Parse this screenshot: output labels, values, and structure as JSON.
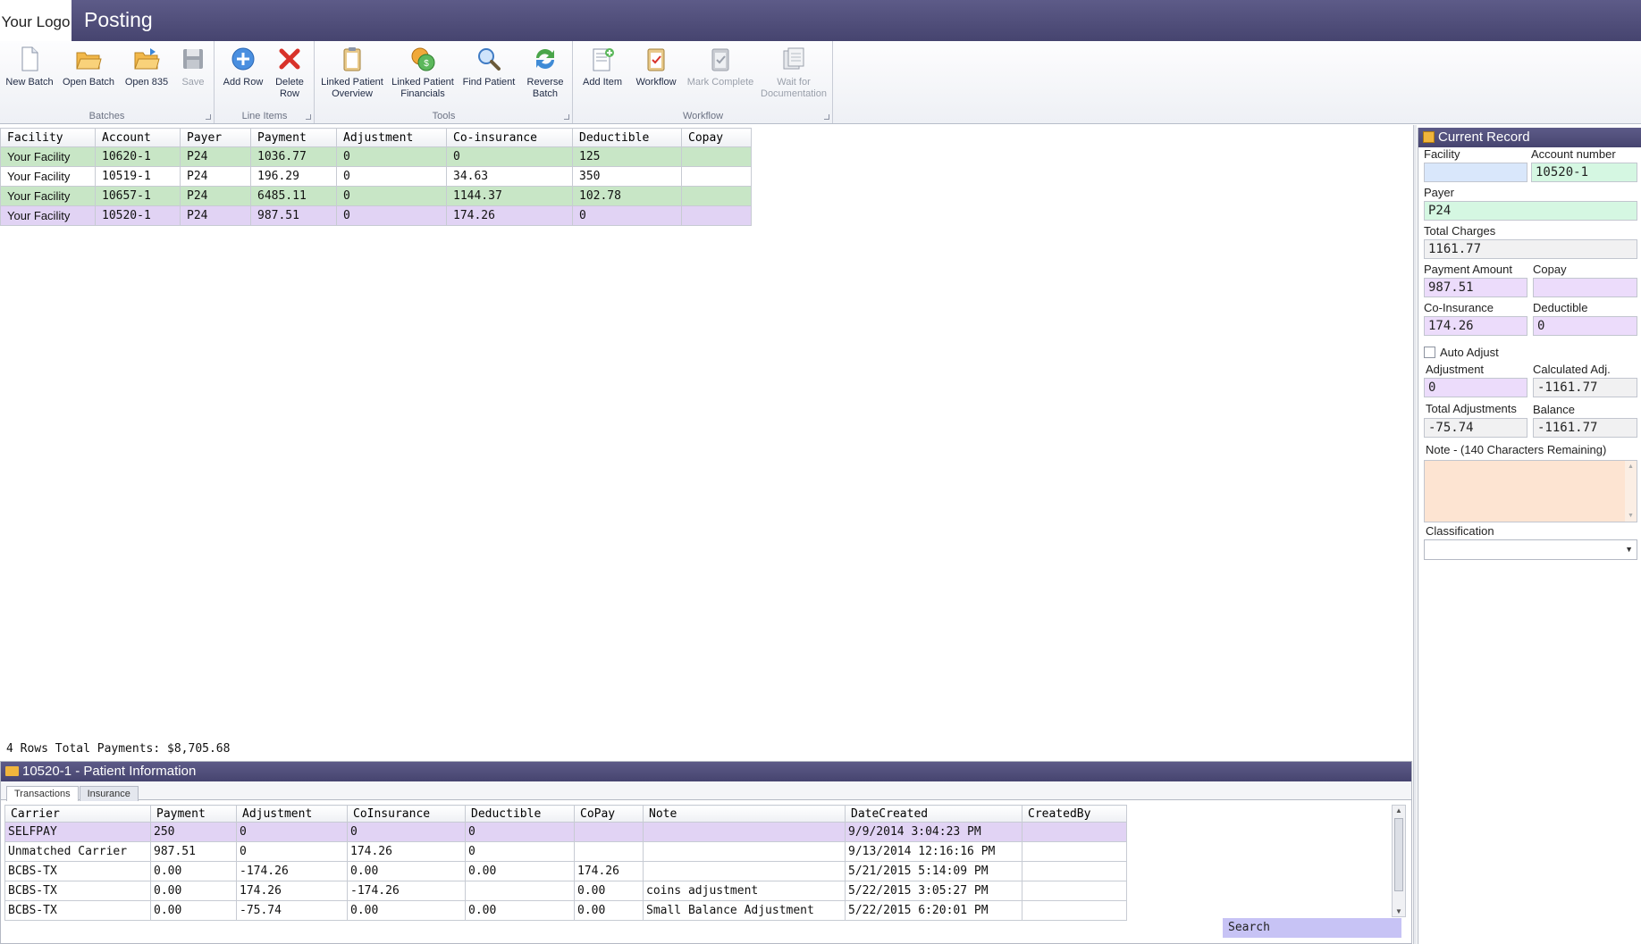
{
  "app": {
    "logo_text": "Your Logo",
    "title": "Posting"
  },
  "ribbon": {
    "groups": [
      {
        "label": "Batches",
        "buttons": [
          {
            "label": "New Batch",
            "icon": "new-document-icon",
            "enabled": true
          },
          {
            "label": "Open Batch",
            "icon": "open-folder-icon",
            "enabled": true
          },
          {
            "label": "Open 835",
            "icon": "open-folder-icon",
            "enabled": true
          },
          {
            "label": "Save",
            "icon": "save-disk-icon",
            "enabled": false
          }
        ]
      },
      {
        "label": "Line Items",
        "buttons": [
          {
            "label": "Add Row",
            "icon": "plus-circle-icon",
            "enabled": true
          },
          {
            "label": "Delete Row",
            "icon": "red-x-icon",
            "enabled": true
          }
        ]
      },
      {
        "label": "Tools",
        "buttons": [
          {
            "label": "Linked Patient Overview",
            "icon": "clipboard-icon",
            "enabled": true
          },
          {
            "label": "Linked Patient Financials",
            "icon": "coins-icon",
            "enabled": true
          },
          {
            "label": "Find Patient",
            "icon": "magnifier-icon",
            "enabled": true
          },
          {
            "label": "Reverse Batch",
            "icon": "refresh-arrows-icon",
            "enabled": true
          }
        ]
      },
      {
        "label": "Workflow",
        "buttons": [
          {
            "label": "Add Item",
            "icon": "add-item-icon",
            "enabled": true
          },
          {
            "label": "Workflow",
            "icon": "workflow-clipboard-icon",
            "enabled": true
          },
          {
            "label": "Mark Complete",
            "icon": "check-clipboard-icon",
            "enabled": false
          },
          {
            "label": "Wait for Documentation",
            "icon": "documents-icon",
            "enabled": false
          }
        ]
      }
    ]
  },
  "batch_grid": {
    "columns": [
      "Facility",
      "Account",
      "Payer",
      "Payment",
      "Adjustment",
      "Co-insurance",
      "Deductible",
      "Copay"
    ],
    "rows": [
      {
        "facility": "Your Facility",
        "account": "10620-1",
        "payer": "P24",
        "payment": "1036.77",
        "adjustment": "0",
        "coinsurance": "0",
        "deductible": "125",
        "copay": "",
        "status": "green"
      },
      {
        "facility": "Your Facility",
        "account": "10519-1",
        "payer": "P24",
        "payment": "196.29",
        "adjustment": "0",
        "coinsurance": "34.63",
        "deductible": "350",
        "copay": "",
        "status": "white"
      },
      {
        "facility": "Your Facility",
        "account": "10657-1",
        "payer": "P24",
        "payment": "6485.11",
        "adjustment": "0",
        "coinsurance": "1144.37",
        "deductible": "102.78",
        "copay": "",
        "status": "green"
      },
      {
        "facility": "Your Facility",
        "account": "10520-1",
        "payer": "P24",
        "payment": "987.51",
        "adjustment": "0",
        "coinsurance": "174.26",
        "deductible": "0",
        "copay": "",
        "status": "selected"
      }
    ],
    "summary": "4 Rows Total Payments: $8,705.68"
  },
  "patient_info": {
    "title": "10520-1 - Patient Information",
    "tabs": [
      "Transactions",
      "Insurance"
    ],
    "active_tab": "Transactions",
    "columns": [
      "Carrier",
      "Payment",
      "Adjustment",
      "CoInsurance",
      "Deductible",
      "CoPay",
      "Note",
      "DateCreated",
      "CreatedBy"
    ],
    "rows": [
      {
        "carrier": "SELFPAY",
        "payment": "250",
        "adjustment": "0",
        "coinsurance": "0",
        "deductible": "0",
        "copay": "",
        "note": "",
        "date": "9/9/2014 3:04:23 PM",
        "created_by": "",
        "selected": true
      },
      {
        "carrier": "Unmatched Carrier",
        "payment": "987.51",
        "adjustment": "0",
        "coinsurance": "174.26",
        "deductible": "0",
        "copay": "",
        "note": "",
        "date": "9/13/2014 12:16:16 PM",
        "created_by": ""
      },
      {
        "carrier": "BCBS-TX",
        "payment": "0.00",
        "adjustment": "-174.26",
        "coinsurance": "0.00",
        "deductible": "0.00",
        "copay": "174.26",
        "note": "",
        "date": "5/21/2015 5:14:09 PM",
        "created_by": ""
      },
      {
        "carrier": "BCBS-TX",
        "payment": "0.00",
        "adjustment": "174.26",
        "coinsurance": "-174.26",
        "deductible": "",
        "copay": "0.00",
        "note": "coins adjustment",
        "date": "5/22/2015 3:05:27 PM",
        "created_by": ""
      },
      {
        "carrier": "BCBS-TX",
        "payment": "0.00",
        "adjustment": "-75.74",
        "coinsurance": "0.00",
        "deductible": "0.00",
        "copay": "0.00",
        "note": "Small Balance Adjustment",
        "date": "5/22/2015 6:20:01 PM",
        "created_by": ""
      }
    ],
    "search_label": "Search"
  },
  "current_record": {
    "title": "Current Record",
    "facility_label": "Facility",
    "facility_value": "",
    "account_label": "Account number",
    "account_value": "10520-1",
    "payer_label": "Payer",
    "payer_value": "P24",
    "total_charges_label": "Total Charges",
    "total_charges_value": "1161.77",
    "payment_amount_label": "Payment Amount",
    "payment_amount_value": "987.51",
    "copay_label": "Copay",
    "copay_value": "",
    "coinsurance_label": "Co-Insurance",
    "coinsurance_value": "174.26",
    "deductible_label": "Deductible",
    "deductible_value": "0",
    "auto_adjust_label": "Auto Adjust",
    "auto_adjust_checked": false,
    "adjustment_label": "Adjustment",
    "adjustment_value": "0",
    "calculated_adj_label": "Calculated Adj.",
    "calculated_adj_value": "-1161.77",
    "total_adjustments_label": "Total Adjustments",
    "total_adjustments_value": "-75.74",
    "balance_label": "Balance",
    "balance_value": "-1161.77",
    "note_label": "Note - (140 Characters Remaining)",
    "note_value": "",
    "classification_label": "Classification",
    "classification_value": ""
  },
  "colors": {
    "titlebar": "#4f4d7c",
    "row_green": "#c8e6c6",
    "row_selected": "#e1d3f4"
  }
}
